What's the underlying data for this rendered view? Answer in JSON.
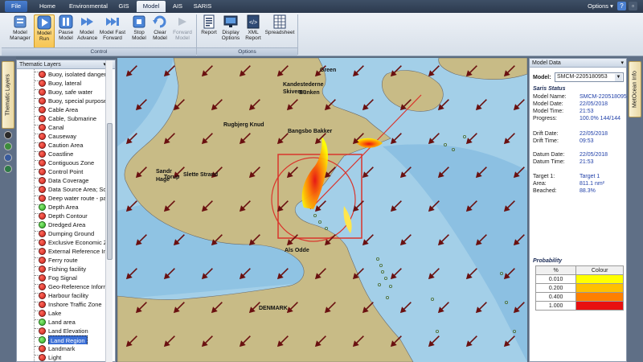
{
  "menubar": {
    "tabs": [
      "File",
      "Home",
      "Environmental",
      "GIS",
      "Model",
      "AIS",
      "SARIS"
    ],
    "active_tab": "Model",
    "options_label": "Options ▾"
  },
  "ribbon": {
    "buttons": [
      {
        "label": "Model Manager",
        "icon": "model-manager-icon"
      },
      {
        "label": "Model Run",
        "icon": "play-icon",
        "pressed": true
      },
      {
        "label": "Pause Model",
        "icon": "pause-icon"
      },
      {
        "label": "Model Advance",
        "icon": "advance-icon"
      },
      {
        "label": "Model Fast Forward",
        "icon": "fast-forward-icon"
      },
      {
        "label": "Stop Model",
        "icon": "stop-icon"
      },
      {
        "label": "Clear Model",
        "icon": "clear-icon"
      },
      {
        "label": "Forward Model",
        "icon": "forward-icon",
        "disabled": true
      },
      {
        "label": "Report",
        "icon": "report-icon"
      },
      {
        "label": "Display Options",
        "icon": "display-icon"
      },
      {
        "label": "XML Report",
        "icon": "xml-icon"
      },
      {
        "label": "Spreadsheet",
        "icon": "spreadsheet-icon"
      }
    ],
    "groups": [
      "Control",
      "Options"
    ]
  },
  "left_dock": {
    "tab_label": "Thematic Layers"
  },
  "right_dock": {
    "tab_label": "MetOcean Info"
  },
  "layers_panel": {
    "title": "Thematic Layers",
    "items": [
      {
        "label": "Buoy, isolated danger",
        "on": false
      },
      {
        "label": "Buoy, lateral",
        "on": false
      },
      {
        "label": "Buoy, safe water",
        "on": false
      },
      {
        "label": "Buoy, special purpose",
        "on": false
      },
      {
        "label": "Cable Area",
        "on": false
      },
      {
        "label": "Cable, Submarine",
        "on": false
      },
      {
        "label": "Canal",
        "on": false
      },
      {
        "label": "Causeway",
        "on": false
      },
      {
        "label": "Caution Area",
        "on": false
      },
      {
        "label": "Coastline",
        "on": false
      },
      {
        "label": "Contiguous Zone",
        "on": false
      },
      {
        "label": "Control Point",
        "on": false
      },
      {
        "label": "Data Coverage",
        "on": false
      },
      {
        "label": "Data Source Area; Sou",
        "on": false
      },
      {
        "label": "Deep water route - pa",
        "on": false
      },
      {
        "label": "Depth Area",
        "on": true
      },
      {
        "label": "Depth Contour",
        "on": false
      },
      {
        "label": "Dredged Area",
        "on": true
      },
      {
        "label": "Dumping Ground",
        "on": false
      },
      {
        "label": "Exclusive Economic Zo",
        "on": false
      },
      {
        "label": "External Reference Info",
        "on": false
      },
      {
        "label": "Ferry route",
        "on": false
      },
      {
        "label": "Fishing facility",
        "on": false
      },
      {
        "label": "Fog Signal",
        "on": false
      },
      {
        "label": "Geo-Reference Inform",
        "on": false
      },
      {
        "label": "Harbour facility",
        "on": false
      },
      {
        "label": "Inshore Traffic Zone",
        "on": false
      },
      {
        "label": "Lake",
        "on": false
      },
      {
        "label": "Land area",
        "on": true
      },
      {
        "label": "Land Elevation",
        "on": false
      },
      {
        "label": "Land Region",
        "on": true,
        "selected": true
      },
      {
        "label": "Landmark",
        "on": false
      },
      {
        "label": "Light",
        "on": false
      }
    ]
  },
  "map": {
    "places": [
      "Green",
      "Kandestederne",
      "Skiveren",
      "Bunken",
      "Rugbjerg Knud",
      "Bangsbo Bakker",
      "Sandr",
      "Hage",
      "Torup",
      "Slette Strand",
      "Als Odde",
      "DENMARK"
    ],
    "colors": {
      "sea": "#a3cfe8",
      "deep_sea": "#7fb6dd",
      "land": "#c8bb86",
      "arrow": "#6a1010",
      "box": "#d9342c"
    }
  },
  "model_panel": {
    "title": "Model Data",
    "model_label": "Model:",
    "model_value": "SMCM-2205180953",
    "section": "Saris Status",
    "status": [
      {
        "k": "Model Name:",
        "v": "SMCM-220518095"
      },
      {
        "k": "Model Date:",
        "v": "22/05/2018"
      },
      {
        "k": "Model Time:",
        "v": "21:53"
      },
      {
        "k": "Progress:",
        "v": "100.0% 144/144"
      }
    ],
    "drift": [
      {
        "k": "Drift Date:",
        "v": "22/05/2018"
      },
      {
        "k": "Drift Time:",
        "v": "09:53"
      }
    ],
    "datum": [
      {
        "k": "Datum Date:",
        "v": "22/05/2018"
      },
      {
        "k": "Datum Time:",
        "v": "21:53"
      }
    ],
    "target": [
      {
        "k": "Target 1:",
        "v": "Target 1"
      },
      {
        "k": "Area:",
        "v": "811.1 nm²"
      },
      {
        "k": "Beached:",
        "v": "88.3%"
      }
    ],
    "probability_title": "Probability",
    "table_headers": [
      "%",
      "Colour"
    ],
    "table": [
      {
        "pct": "0.010",
        "color": "#ffff00"
      },
      {
        "pct": "0.200",
        "color": "#ffc000"
      },
      {
        "pct": "0.400",
        "color": "#ff8000"
      },
      {
        "pct": "1.000",
        "color": "#e81010"
      }
    ]
  }
}
